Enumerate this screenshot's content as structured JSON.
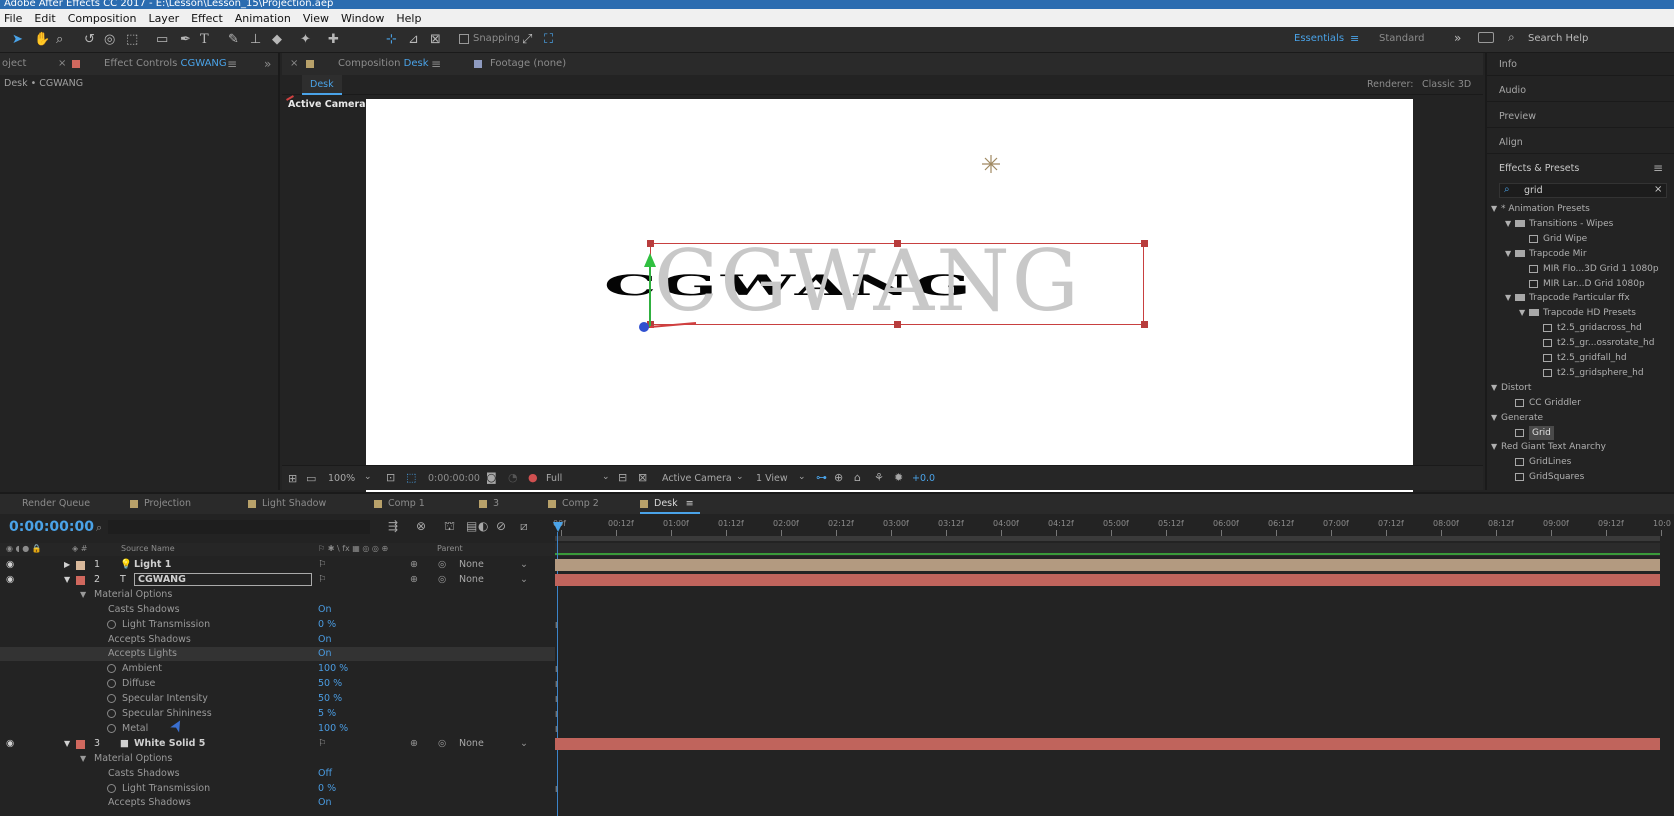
{
  "window": {
    "title": "Adobe After Effects CC 2017 - E:\\Lesson\\Lesson_15\\Projection.aep"
  },
  "menu": [
    "File",
    "Edit",
    "Composition",
    "Layer",
    "Effect",
    "Animation",
    "View",
    "Window",
    "Help"
  ],
  "toolbar": {
    "snapping": "Snapping",
    "workspace_active": "Essentials",
    "workspace_other": "Standard",
    "search_placeholder": "Search Help"
  },
  "project_panel": {
    "tab": "oject",
    "effect_controls_tab": "Effect Controls",
    "effect_controls_layer": "CGWANG",
    "breadcrumb": "Desk • CGWANG"
  },
  "composition_panel": {
    "tab_label": "Composition",
    "tab_comp": "Desk",
    "footage_tab": "Footage (none)",
    "subtab": "Desk",
    "renderer_label": "Renderer:",
    "renderer_value": "Classic 3D",
    "active_camera_label": "Active Camera",
    "canvas_text": "CGWANG",
    "bottom": {
      "zoom": "100%",
      "timecode": "0:00:00:00",
      "resolution": "Full",
      "view": "Active Camera",
      "views": "1 View",
      "exposure": "+0.0"
    }
  },
  "right_panel": {
    "sections": [
      "Info",
      "Audio",
      "Preview",
      "Align"
    ],
    "effects_title": "Effects & Presets",
    "search_value": "grid",
    "tree": [
      {
        "level": 0,
        "label": "* Animation Presets",
        "folder": false
      },
      {
        "level": 1,
        "label": "Transitions - Wipes",
        "folder": true
      },
      {
        "level": 2,
        "label": "Grid Wipe",
        "folder": false
      },
      {
        "level": 1,
        "label": "Trapcode Mir",
        "folder": true
      },
      {
        "level": 2,
        "label": "MIR Flo...3D Grid 1 1080p",
        "folder": false
      },
      {
        "level": 2,
        "label": "MIR Lar...D Grid 1080p",
        "folder": false
      },
      {
        "level": 1,
        "label": "Trapcode Particular ffx",
        "folder": true
      },
      {
        "level": 2,
        "label": "Trapcode HD Presets",
        "folder": true
      },
      {
        "level": 3,
        "label": "t2.5_gridacross_hd",
        "folder": false
      },
      {
        "level": 3,
        "label": "t2.5_gr...ossrotate_hd",
        "folder": false
      },
      {
        "level": 3,
        "label": "t2.5_gridfall_hd",
        "folder": false
      },
      {
        "level": 3,
        "label": "t2.5_gridsphere_hd",
        "folder": false
      },
      {
        "level": 0,
        "label": "Distort",
        "folder": false
      },
      {
        "level": 1,
        "label": "CC Griddler",
        "folder": false
      },
      {
        "level": 0,
        "label": "Generate",
        "folder": false
      },
      {
        "level": 1,
        "label": "Grid",
        "folder": false,
        "selected": true
      },
      {
        "level": 0,
        "label": "Red Giant Text Anarchy",
        "folder": false
      },
      {
        "level": 1,
        "label": "GridLines",
        "folder": false
      },
      {
        "level": 1,
        "label": "GridSquares",
        "folder": false
      }
    ]
  },
  "timeline": {
    "tabs": [
      {
        "label": "Render Queue",
        "color": ""
      },
      {
        "label": "Projection",
        "color": "#b8a16a"
      },
      {
        "label": "Light Shadow",
        "color": "#b8a16a"
      },
      {
        "label": "Comp 1",
        "color": "#b8a16a"
      },
      {
        "label": "3",
        "color": "#b8a16a"
      },
      {
        "label": "Comp 2",
        "color": "#b8a16a"
      },
      {
        "label": "Desk",
        "color": "#b8a16a"
      }
    ],
    "timecode": "0:00:00:00",
    "columns": {
      "source_name": "Source Name",
      "parent": "Parent"
    },
    "ruler": [
      "00f",
      "00:12f",
      "01:00f",
      "01:12f",
      "02:00f",
      "02:12f",
      "03:00f",
      "03:12f",
      "04:00f",
      "04:12f",
      "05:00f",
      "05:12f",
      "06:00f",
      "06:12f",
      "07:00f",
      "07:12f",
      "08:00f",
      "08:12f",
      "09:00f",
      "09:12f",
      "10:0"
    ],
    "layers": [
      {
        "num": "1",
        "name": "Light 1",
        "color": "#d8b89a",
        "parent": "None",
        "bar": "#b39a80"
      },
      {
        "num": "2",
        "name": "CGWANG",
        "color": "#d0685e",
        "parent": "None",
        "bar": "#c0645c"
      },
      {
        "num": "3",
        "name": "White Solid 5",
        "color": "#d0685e",
        "parent": "None",
        "bar": "#c0645c"
      }
    ],
    "material_label": "Material Options",
    "props_cgwang": [
      {
        "name": "Casts Shadows",
        "value": "On",
        "stopwatch": false
      },
      {
        "name": "Light Transmission",
        "value": "0 %",
        "stopwatch": true
      },
      {
        "name": "Accepts Shadows",
        "value": "On",
        "stopwatch": false
      },
      {
        "name": "Accepts Lights",
        "value": "On",
        "stopwatch": false
      },
      {
        "name": "Ambient",
        "value": "100 %",
        "stopwatch": true
      },
      {
        "name": "Diffuse",
        "value": "50 %",
        "stopwatch": true
      },
      {
        "name": "Specular Intensity",
        "value": "50 %",
        "stopwatch": true
      },
      {
        "name": "Specular Shininess",
        "value": "5 %",
        "stopwatch": true
      },
      {
        "name": "Metal",
        "value": "100 %",
        "stopwatch": true
      }
    ],
    "props_solid": [
      {
        "name": "Casts Shadows",
        "value": "Off",
        "stopwatch": false
      },
      {
        "name": "Light Transmission",
        "value": "0 %",
        "stopwatch": true
      },
      {
        "name": "Accepts Shadows",
        "value": "On",
        "stopwatch": false
      }
    ]
  }
}
